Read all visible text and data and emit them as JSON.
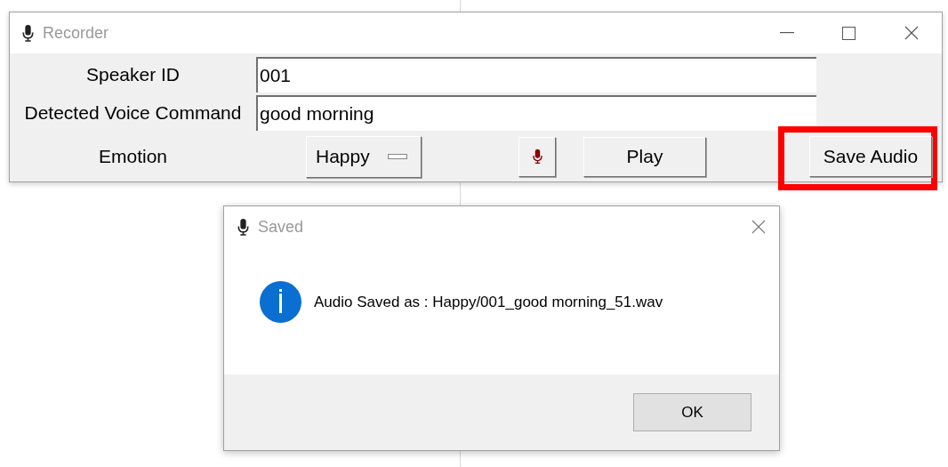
{
  "recorder": {
    "title": "Recorder",
    "fields": [
      {
        "label": "Speaker ID",
        "value": "001"
      },
      {
        "label": "Detected Voice Command",
        "value": "good morning"
      }
    ],
    "emotion": {
      "label": "Emotion",
      "value": "Happy"
    },
    "play_button": "Play",
    "save_button": {
      "label": "Save Audio",
      "highlighted": true
    }
  },
  "dialog": {
    "title": "Saved",
    "message": "Audio Saved as : Happy/001_good morning_51.wav",
    "button": "OK"
  }
}
